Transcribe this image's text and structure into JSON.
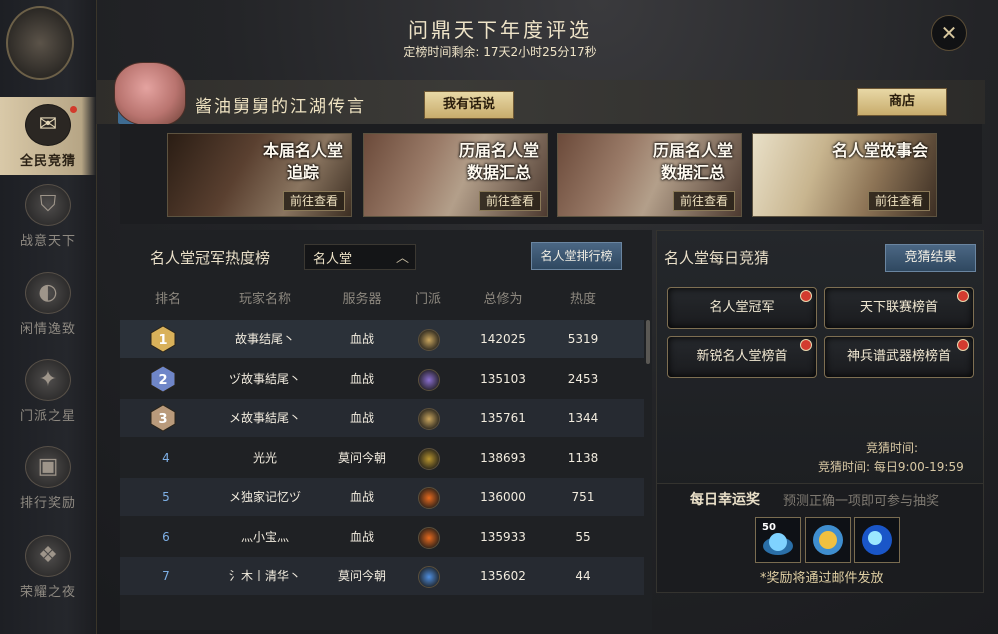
{
  "header": {
    "title": "问鼎天下年度评选",
    "countdown": "定榜时间剩余: 17天2小时25分17秒",
    "close_icon": "close-icon"
  },
  "sidebar": {
    "items": [
      {
        "label": "全民竞猜",
        "icon": "envelope-icon",
        "active": true
      },
      {
        "label": "战意天下",
        "icon": "helmet-icon"
      },
      {
        "label": "闲情逸致",
        "icon": "drum-icon"
      },
      {
        "label": "门派之星",
        "icon": "star-icon"
      },
      {
        "label": "排行奖励",
        "icon": "chest-icon"
      },
      {
        "label": "荣耀之夜",
        "icon": "crest-icon"
      }
    ]
  },
  "banner": {
    "text": "酱油舅舅的江湖传言",
    "speak_button": "我有话说",
    "shop_button": "商店"
  },
  "cards": [
    {
      "title1": "本届名人堂",
      "title2": "追踪",
      "go": "前往查看"
    },
    {
      "title1": "历届名人堂",
      "title2": "数据汇总",
      "go": "前往查看"
    },
    {
      "title1": "历届名人堂",
      "title2": "数据汇总",
      "go": "前往查看"
    },
    {
      "title1": "名人堂故事会",
      "title2": "",
      "go": "前往查看"
    }
  ],
  "ranking": {
    "title": "名人堂冠军热度榜",
    "dropdown_value": "名人堂",
    "board_button": "名人堂排行榜",
    "columns": [
      "排名",
      "玩家名称",
      "服务器",
      "门派",
      "总修为",
      "热度"
    ],
    "rows": [
      {
        "rank": "1",
        "name": "故事结尾丶",
        "server": "血战",
        "sect_color": "#caa65e",
        "power": "142025",
        "heat": "5319"
      },
      {
        "rank": "2",
        "name": "ヅ故事結尾丶",
        "server": "血战",
        "sect_color": "#8b6fd0",
        "power": "135103",
        "heat": "2453"
      },
      {
        "rank": "3",
        "name": "メ故事結尾丶",
        "server": "血战",
        "sect_color": "#caa65e",
        "power": "135761",
        "heat": "1344"
      },
      {
        "rank": "4",
        "name": "光光",
        "server": "莫问今朝",
        "sect_color": "#b8952f",
        "power": "138693",
        "heat": "1138"
      },
      {
        "rank": "5",
        "name": "メ独家记忆ヅ",
        "server": "血战",
        "sect_color": "#e86a1e",
        "power": "136000",
        "heat": "751"
      },
      {
        "rank": "6",
        "name": "灬小宝灬",
        "server": "血战",
        "sect_color": "#e86a1e",
        "power": "135933",
        "heat": "55"
      },
      {
        "rank": "7",
        "name": "氵木丨清华丶",
        "server": "莫问今朝",
        "sect_color": "#4f8fe0",
        "power": "135602",
        "heat": "44"
      }
    ]
  },
  "guess": {
    "title": "名人堂每日竞猜",
    "result_button": "竞猜结果",
    "options": [
      "名人堂冠军",
      "天下联赛榜首",
      "新锐名人堂榜首",
      "神兵谱武器榜榜首"
    ],
    "time_label": "竞猜时间:",
    "time_value": "竞猜时间: 每日9:00-19:59"
  },
  "lucky": {
    "title": "每日幸运奖",
    "desc": "预测正确一项即可参与抽奖",
    "prize_badge": "50",
    "note": "*奖励将通过邮件发放",
    "prizes": [
      "blue-orb-icon",
      "gold-medal-icon",
      "blue-sphere-icon"
    ]
  }
}
